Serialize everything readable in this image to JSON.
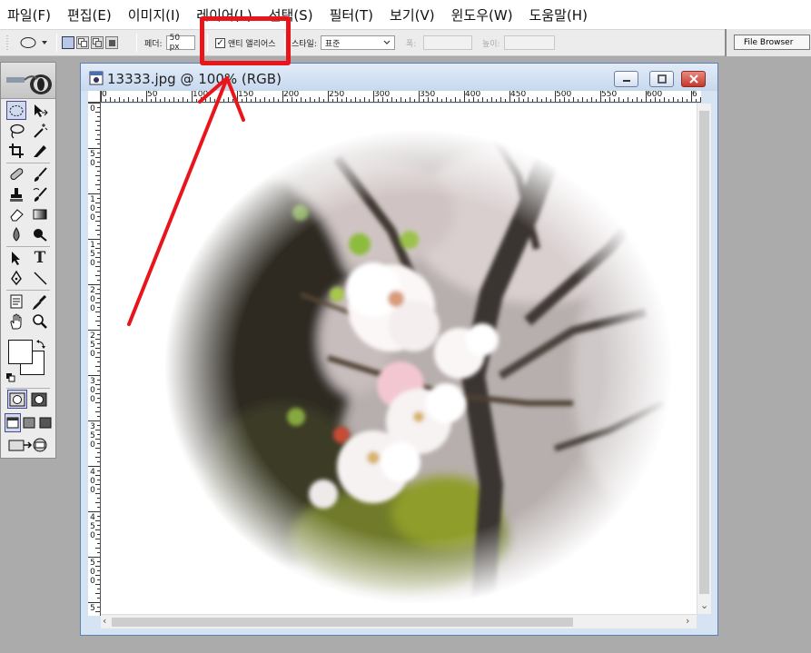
{
  "menubar": {
    "items": [
      "파일(F)",
      "편집(E)",
      "이미지(I)",
      "레이어(L)",
      "선택(S)",
      "필터(T)",
      "보기(V)",
      "윈도우(W)",
      "도움말(H)"
    ]
  },
  "options_bar": {
    "feather_label": "페더:",
    "feather_value": "50 px",
    "antialias_label": "앤티 앨리어스",
    "antialias_checked": true,
    "style_label": "스타일:",
    "style_value": "표준",
    "width_label": "폭:",
    "height_label": "높이:"
  },
  "palette_well": {
    "file_browser_label": "File Browser"
  },
  "document": {
    "title": "13333.jpg @ 100% (RGB)",
    "ruler_top_labels": [
      "0",
      "50",
      "100",
      "150",
      "200",
      "250",
      "300",
      "350",
      "400",
      "450",
      "500",
      "550",
      "600",
      "6"
    ],
    "ruler_left_labels": [
      "0",
      "50",
      "100",
      "150",
      "200",
      "250",
      "300",
      "350",
      "400",
      "450",
      "500",
      "5"
    ]
  },
  "colors": {
    "highlight": "#e8151b",
    "arrow": "#e8151b",
    "title_bar": "#c7d8ee",
    "close_button": "#c4392c"
  },
  "icons": {
    "toolbox": [
      "marquee-elliptical-icon",
      "move-icon",
      "lasso-icon",
      "magic-wand-icon",
      "crop-icon",
      "slice-icon",
      "healing-brush-icon",
      "brush-icon",
      "clone-stamp-icon",
      "history-brush-icon",
      "eraser-icon",
      "gradient-icon",
      "blur-icon",
      "dodge-icon",
      "path-selection-icon",
      "type-icon",
      "pen-icon",
      "line-icon",
      "notes-icon",
      "eyedropper-icon",
      "hand-icon",
      "zoom-icon"
    ]
  }
}
